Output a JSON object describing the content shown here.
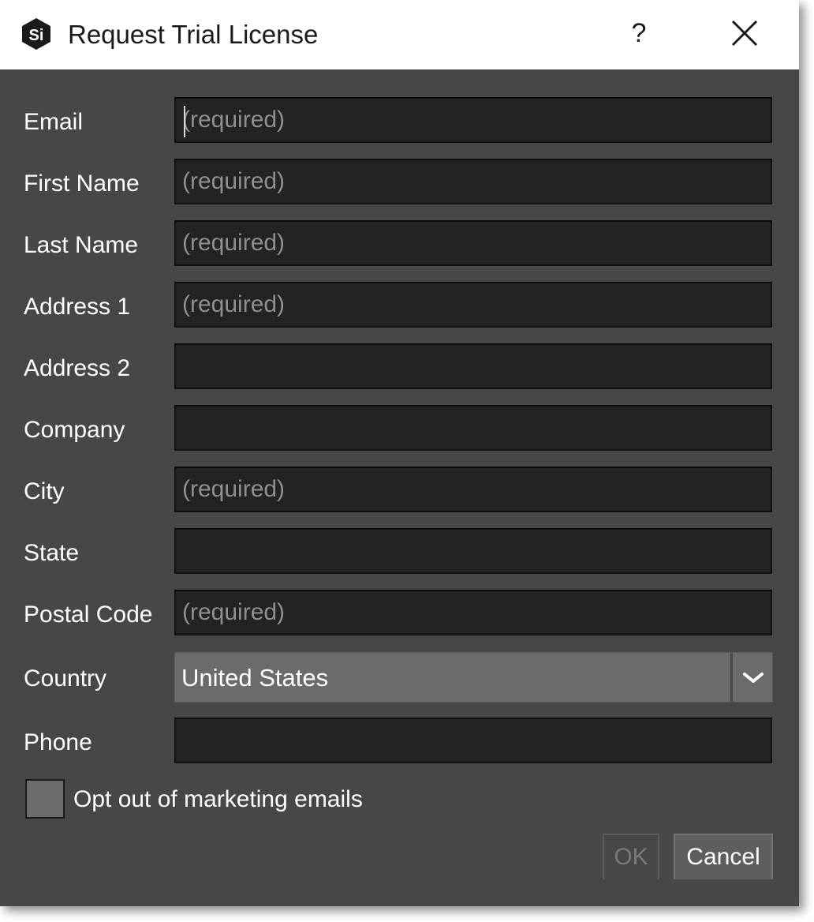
{
  "window": {
    "title": "Request Trial License",
    "help_label": "?",
    "app_icon": "si-logo-icon",
    "close_icon": "close-icon"
  },
  "form": {
    "fields": [
      {
        "label": "Email",
        "value": "",
        "placeholder": "(required)"
      },
      {
        "label": "First Name",
        "value": "",
        "placeholder": "(required)"
      },
      {
        "label": "Last Name",
        "value": "",
        "placeholder": "(required)"
      },
      {
        "label": "Address 1",
        "value": "",
        "placeholder": "(required)"
      },
      {
        "label": "Address 2",
        "value": "",
        "placeholder": ""
      },
      {
        "label": "Company",
        "value": "",
        "placeholder": ""
      },
      {
        "label": "City",
        "value": "",
        "placeholder": "(required)"
      },
      {
        "label": "State",
        "value": "",
        "placeholder": ""
      },
      {
        "label": "Postal Code",
        "value": "",
        "placeholder": "(required)"
      }
    ],
    "country": {
      "label": "Country",
      "value": "United States"
    },
    "phone": {
      "label": "Phone",
      "value": "",
      "placeholder": ""
    },
    "opt_out": {
      "label": "Opt out of marketing emails",
      "checked": false
    }
  },
  "buttons": {
    "ok_label": "OK",
    "ok_enabled": false,
    "cancel_label": "Cancel"
  },
  "colors": {
    "dialog_background": "#474747",
    "input_background": "#232323",
    "combo_background": "#6b6b6b",
    "text": "#ffffff",
    "placeholder": "#8f8f8f"
  }
}
